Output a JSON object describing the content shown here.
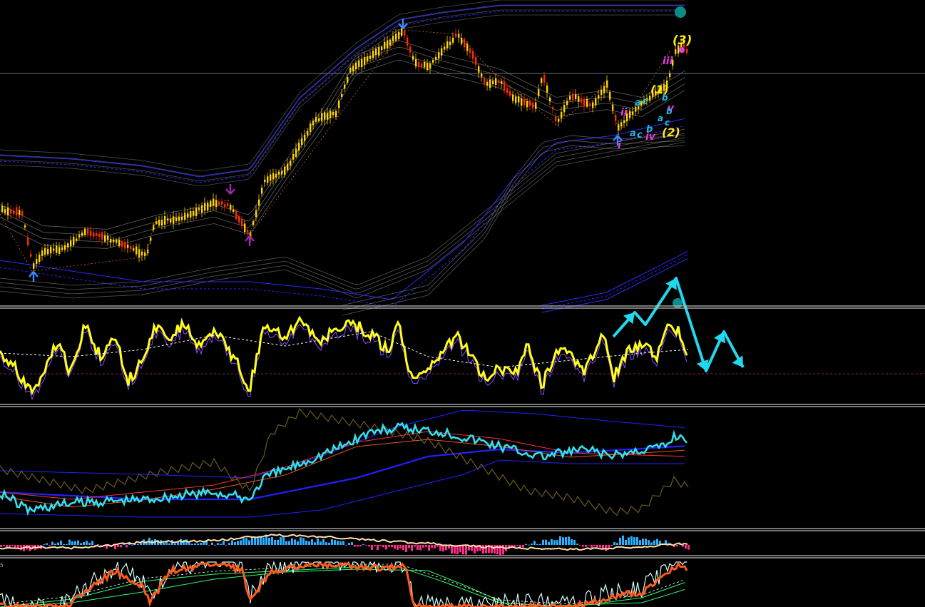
{
  "chart_data": [
    {
      "type": "candlestick",
      "panel": "price",
      "colors": {
        "up": "#ffd400",
        "down": "#ff2a00",
        "upper_band": "#2a2aff",
        "envelope": "#a9a9a9"
      },
      "wave_labels": {
        "major": [
          "(1)",
          "(2)",
          "(3)"
        ],
        "minor": [
          "i",
          "ii",
          "iii",
          "iv",
          "v"
        ],
        "corrective": [
          "a",
          "b",
          "c"
        ]
      },
      "arrows": {
        "up": 3,
        "down": 2,
        "up_colors": [
          "#3a8dff",
          "#9a2aa8"
        ],
        "down_colors": [
          "#3a8dff",
          "#9a2aa8"
        ]
      }
    },
    {
      "type": "line",
      "panel": "oscillator",
      "series": [
        {
          "color": "#ffff1a"
        },
        {
          "color": "#8a4dff"
        },
        {
          "color": "#ffffff",
          "style": "dashed"
        }
      ],
      "projection_color": "#22d8ee"
    },
    {
      "type": "line",
      "panel": "moving-average",
      "series": [
        {
          "color": "#33e0f0"
        },
        {
          "color": "#2020ff"
        },
        {
          "color": "#e05a20"
        },
        {
          "color": "#6a5a20"
        },
        {
          "color": "#ff3030"
        }
      ]
    },
    {
      "type": "bar",
      "panel": "histogram",
      "colors": {
        "positive": "#2ab0ff",
        "negative": "#ff2a8a",
        "line": "#ffe0b0"
      }
    },
    {
      "type": "line",
      "panel": "stochastic",
      "series": [
        {
          "color": "#ff5a1a"
        },
        {
          "color": "#d0ffff"
        },
        {
          "color": "#2aff6a"
        }
      ]
    }
  ],
  "corner_label": "5"
}
